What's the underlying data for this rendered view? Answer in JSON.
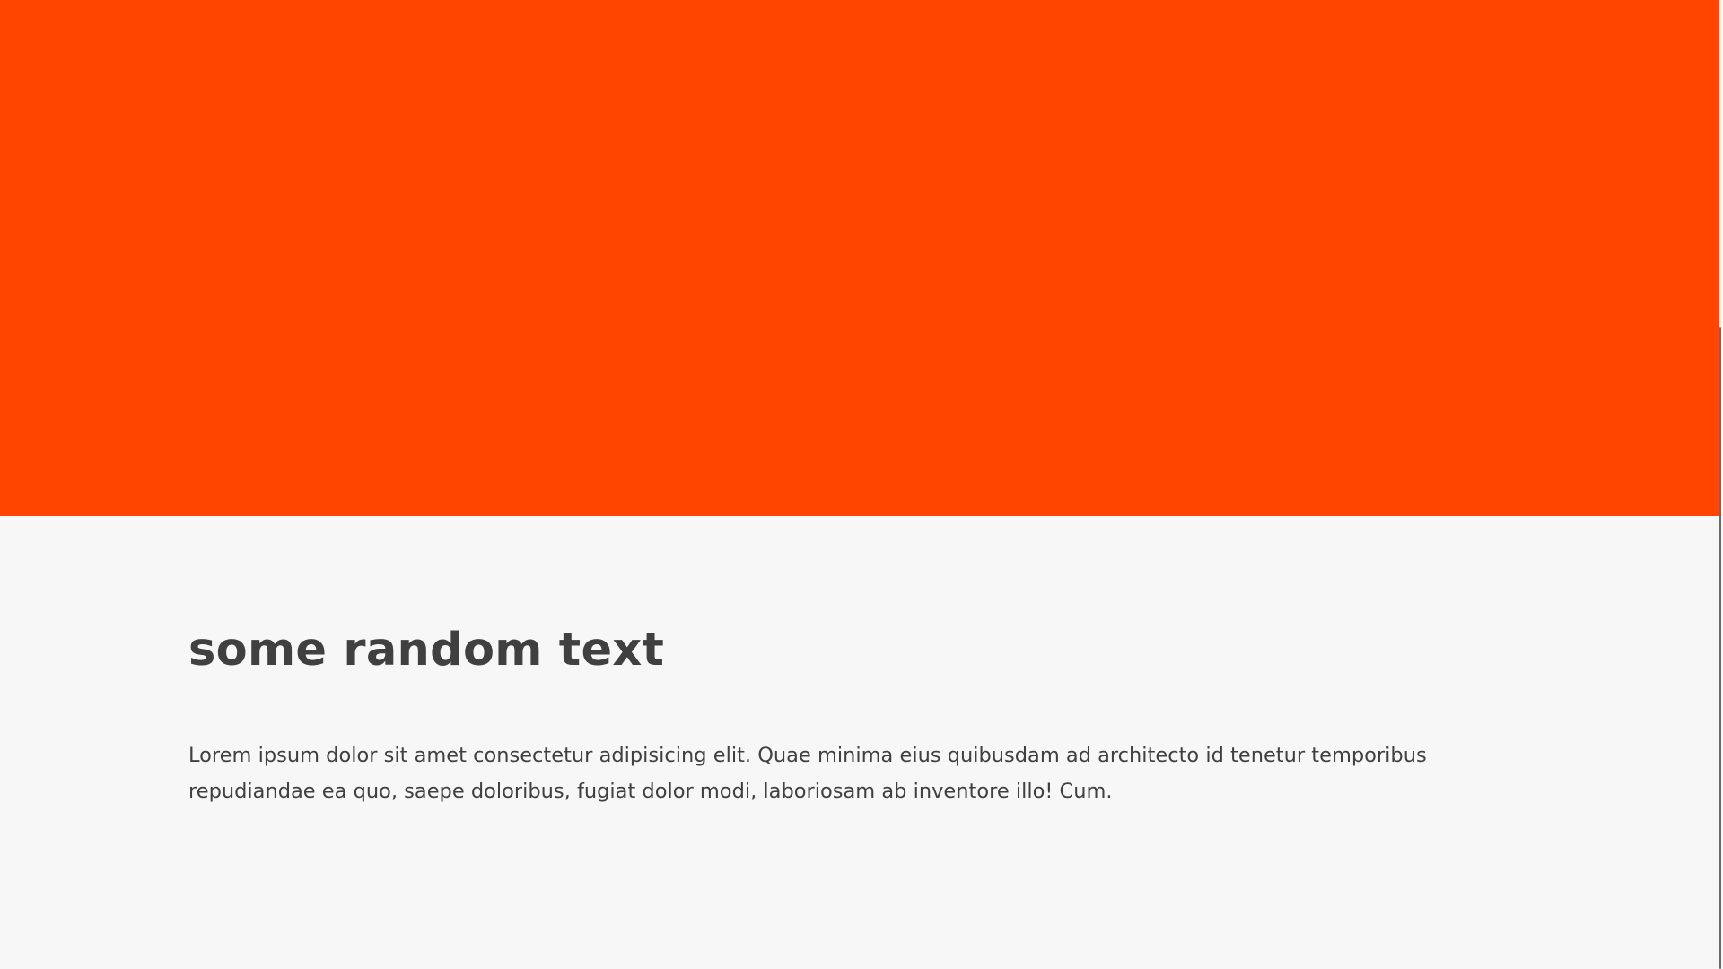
{
  "colors": {
    "hero_background": "#ff4500",
    "page_background": "#f7f7f7",
    "text": "#404040"
  },
  "content": {
    "heading": "some random text",
    "paragraph": "Lorem ipsum dolor sit amet consectetur adipisicing elit. Quae minima eius quibusdam ad architecto id tenetur temporibus repudiandae ea quo, saepe doloribus, fugiat dolor modi, laboriosam ab inventore illo! Cum."
  }
}
